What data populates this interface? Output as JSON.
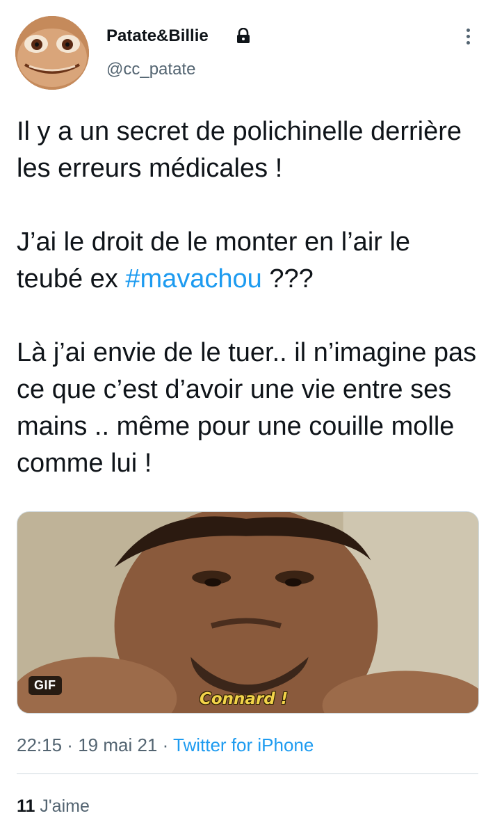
{
  "author": {
    "display_name": "Patate&Billie",
    "handle": "@cc_patate",
    "protected_icon": "lock-icon",
    "avatar_icon": "frog-face-avatar"
  },
  "menu_icon": "more-vertical-icon",
  "tweet": {
    "paragraphs": [
      "Il y a un secret de polichinelle derrière les erreurs médicales !",
      "J’ai le droit de le monter en l’air le teubé ex",
      "Là j’ai envie de le tuer.. il n’imagine pas ce que c’est d’avoir une vie entre ses mains .. même pour une couille molle comme lui !"
    ],
    "hashtag": "#mavachou",
    "after_hashtag": " ???"
  },
  "media": {
    "badge": "GIF",
    "caption": "Connard !"
  },
  "meta": {
    "time": "22:15",
    "separator": " · ",
    "date": "19 mai 21",
    "source": "Twitter for iPhone"
  },
  "stats": {
    "likes_count": "11",
    "likes_label": "J'aime"
  },
  "colors": {
    "accent": "#1d9bf0",
    "secondary_text": "#536471",
    "primary_text": "#0f1419",
    "caption": "#f2d34a"
  }
}
